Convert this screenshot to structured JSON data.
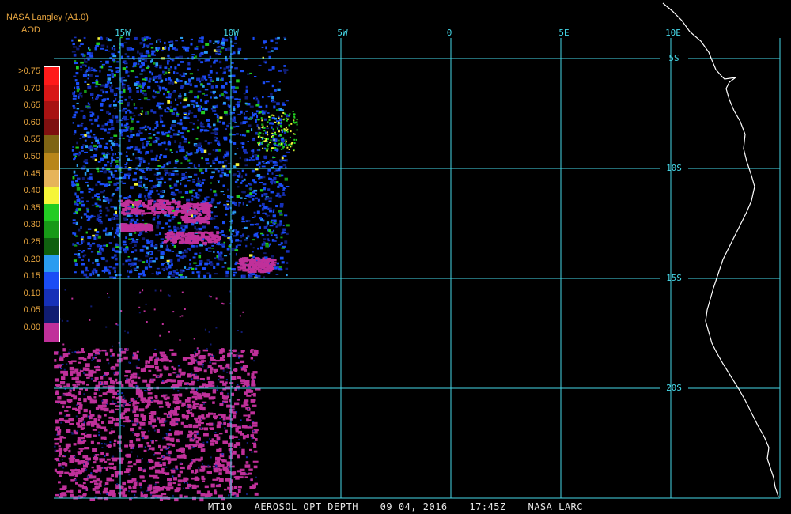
{
  "header": {
    "source": "NASA Langley (A1.0)",
    "variable": "AOD"
  },
  "legend": {
    "items": [
      {
        "label": ">0.75",
        "color": "#ff1a1a"
      },
      {
        "label": "0.70",
        "color": "#d81616"
      },
      {
        "label": "0.65",
        "color": "#a81212"
      },
      {
        "label": "0.60",
        "color": "#7e1010"
      },
      {
        "label": "0.55",
        "color": "#7e6414"
      },
      {
        "label": "0.50",
        "color": "#b8861a"
      },
      {
        "label": "0.45",
        "color": "#e6b45a"
      },
      {
        "label": "0.40",
        "color": "#f5f538"
      },
      {
        "label": "0.35",
        "color": "#22cc22"
      },
      {
        "label": "0.30",
        "color": "#179917"
      },
      {
        "label": "0.25",
        "color": "#0f600f"
      },
      {
        "label": "0.20",
        "color": "#2a9cf0"
      },
      {
        "label": "0.15",
        "color": "#1a4cf5"
      },
      {
        "label": "0.10",
        "color": "#1630b8"
      },
      {
        "label": "0.05",
        "color": "#101c72"
      },
      {
        "label": "0.00",
        "color": "#c0309a"
      }
    ]
  },
  "map": {
    "lon_labels": [
      "15W",
      "10W",
      "5W",
      "0",
      "5E",
      "10E"
    ],
    "lat_labels": [
      "5S",
      "10S",
      "15S",
      "20S"
    ],
    "grid_color": "#46d8e8",
    "coast_color": "#ffffff"
  },
  "caption": {
    "product": "MT10",
    "parameter": "AEROSOL OPT DEPTH",
    "date": "09 04, 2016",
    "time": "17:45Z",
    "center": "NASA LARC"
  }
}
